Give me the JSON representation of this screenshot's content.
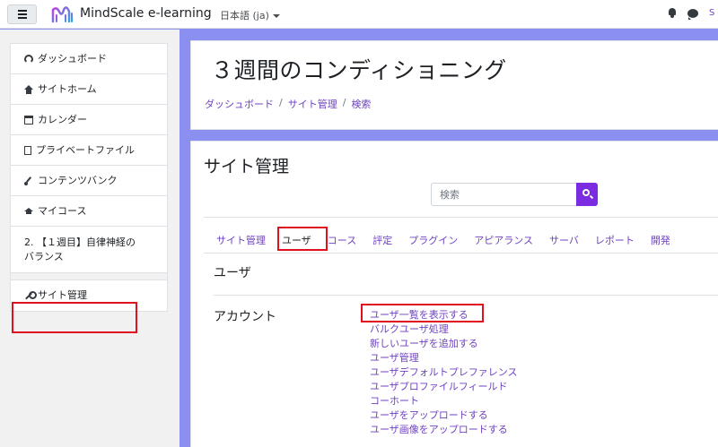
{
  "navbar": {
    "site_name": "MindScale e-learning",
    "language": "日本語 (ja)",
    "right_edge_text": "S"
  },
  "sidebar": {
    "items": [
      {
        "label": "ダッシュボード",
        "icon": "dashboard-icon"
      },
      {
        "label": "サイトホーム",
        "icon": "home-icon"
      },
      {
        "label": "カレンダー",
        "icon": "calendar-icon"
      },
      {
        "label": "プライベートファイル",
        "icon": "file-icon"
      },
      {
        "label": "コンテンツバンク",
        "icon": "paintbrush-icon"
      },
      {
        "label": "マイコース",
        "icon": "graduation-cap-icon"
      },
      {
        "label": "2. 【１週目】自律神経の\nバランス",
        "icon": ""
      },
      {
        "label": "サイト管理",
        "icon": "wrench-icon"
      }
    ]
  },
  "header": {
    "title": "３週間のコンディショニング",
    "breadcrumb": [
      "ダッシュボード",
      "サイト管理",
      "検索"
    ]
  },
  "main": {
    "section_title": "サイト管理",
    "search": {
      "placeholder": "検索"
    },
    "tabs": [
      "サイト管理",
      "ユーザ",
      "コース",
      "評定",
      "プラグイン",
      "アピアランス",
      "サーバ",
      "レポート",
      "開発"
    ],
    "active_tab": "ユーザ",
    "users_heading": "ユーザ",
    "account_heading": "アカウント",
    "account_links": [
      "ユーザ一覧を表示する",
      "バルクユーザ処理",
      "新しいユーザを追加する",
      "ユーザ管理",
      "ユーザデフォルトプレファレンス",
      "ユーザプロファイルフィールド",
      "コーホート",
      "ユーザをアップロードする",
      "ユーザ画像をアップロードする"
    ]
  },
  "colors": {
    "accent": "#6f42c1",
    "search_button": "#7b2be0",
    "page_background": "#8b8ff0",
    "highlight_box": "#e0101e"
  }
}
